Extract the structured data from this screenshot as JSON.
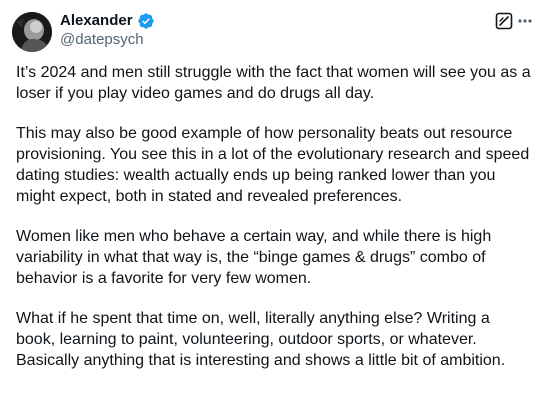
{
  "author": {
    "display_name": "Alexander",
    "handle": "@datepsych",
    "verified_icon": "verified-badge-icon",
    "verified_color": "#1d9bf0"
  },
  "actions": {
    "grok_icon": "grok-icon",
    "more_icon": "more-options-icon"
  },
  "tweet": {
    "paragraphs": [
      "It’s 2024 and men still struggle with the fact that women will see you as a loser if you play video games and do drugs all day.",
      "This may also be good example of how personality beats out resource provisioning. You see this in a lot of the evolutionary research and speed dating studies: wealth actually ends up being ranked lower than you might expect, both in stated and revealed preferences.",
      "Women like men who behave a certain way, and while there is high variability in what that way is, the “binge games & drugs” combo of behavior is a favorite for very few women.",
      "What if he spent that time on, well, literally anything else? Writing a book, learning to paint, volunteering, outdoor sports, or whatever. Basically anything that is interesting and shows a little bit of ambition."
    ]
  },
  "colors": {
    "text_primary": "#0f1419",
    "text_secondary": "#536471",
    "background": "#ffffff"
  }
}
